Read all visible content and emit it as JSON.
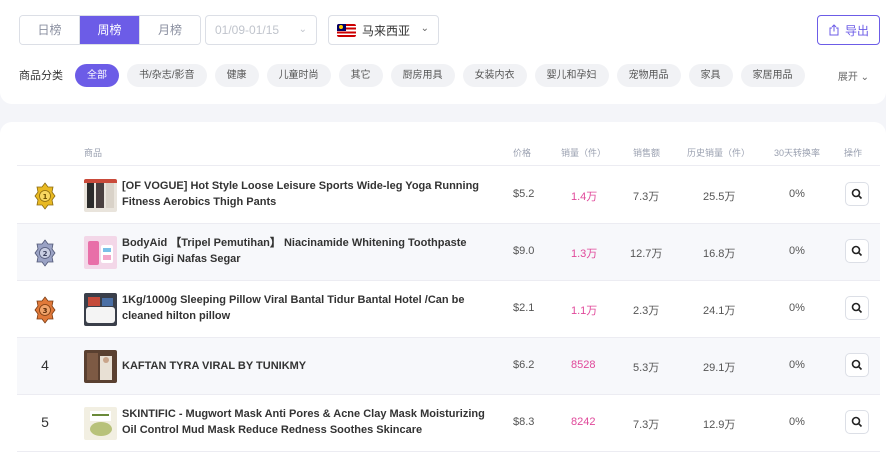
{
  "tabs": [
    {
      "label": "日榜"
    },
    {
      "label": "周榜",
      "active": true
    },
    {
      "label": "月榜"
    }
  ],
  "date_range": "01/09-01/15",
  "country": {
    "label": "马来西亚",
    "flag": "malaysia-flag"
  },
  "export_label": "导出",
  "categories": {
    "title": "商品分类",
    "chips": [
      "全部",
      "书/杂志/影音",
      "健康",
      "儿童时尚",
      "其它",
      "厨房用具",
      "女装内衣",
      "婴儿和孕妇",
      "宠物用品",
      "家具",
      "家居用品"
    ],
    "expand_label": "展开"
  },
  "table": {
    "headers": {
      "product": "商品",
      "price": "价格",
      "sales": "销量（件）",
      "revenue": "销售额",
      "history_sales": "历史销量（件）",
      "conversion": "30天转换率",
      "action": "操作"
    },
    "rows": [
      {
        "rank": "1",
        "medal": "gold",
        "name": "[OF VOGUE] Hot Style Loose Leisure Sports Wide-leg Yoga Running Fitness Aerobics Thigh Pants",
        "price": "$5.2",
        "sales": "1.4万",
        "revenue": "7.3万",
        "history_sales": "25.5万",
        "conversion": "0%"
      },
      {
        "rank": "2",
        "medal": "silver",
        "name": "BodyAid 【Tripel Pemutihan】 Niacinamide Whitening Toothpaste Putih Gigi Nafas Segar",
        "price": "$9.0",
        "sales": "1.3万",
        "revenue": "12.7万",
        "history_sales": "16.8万",
        "conversion": "0%"
      },
      {
        "rank": "3",
        "medal": "bronze",
        "name": "1Kg/1000g Sleeping Pillow Viral Bantal Tidur Bantal Hotel /Can be cleaned hilton pillow",
        "price": "$2.1",
        "sales": "1.1万",
        "revenue": "2.3万",
        "history_sales": "24.1万",
        "conversion": "0%"
      },
      {
        "rank": "4",
        "name": "KAFTAN TYRA VIRAL BY TUNIKMY",
        "price": "$6.2",
        "sales": "8528",
        "revenue": "5.3万",
        "history_sales": "29.1万",
        "conversion": "0%"
      },
      {
        "rank": "5",
        "name": "SKINTIFIC - Mugwort Mask Anti Pores & Acne Clay Mask Moisturizing Oil Control Mud Mask Reduce Redness Soothes Skincare",
        "price": "$8.3",
        "sales": "8242",
        "revenue": "7.3万",
        "history_sales": "12.9万",
        "conversion": "0%"
      }
    ]
  },
  "colors": {
    "accent": "#6c5ce7",
    "sales_highlight": "#e0489a",
    "gold": "#e8b923",
    "silver": "#9aa2c4",
    "bronze": "#e0793a"
  }
}
